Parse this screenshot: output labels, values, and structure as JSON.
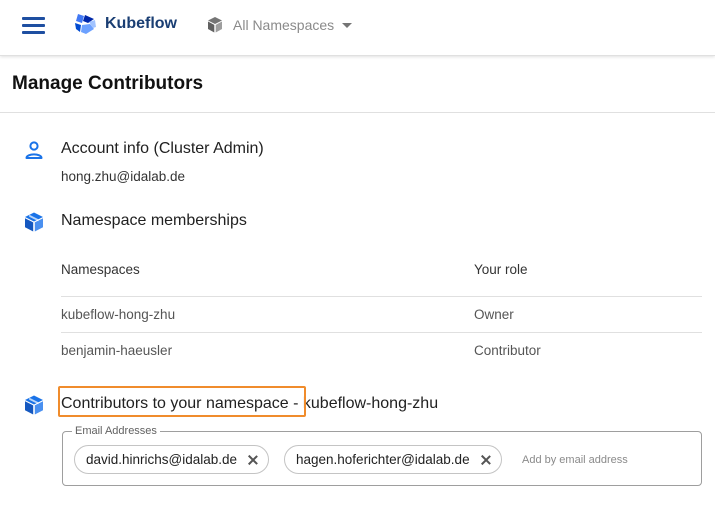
{
  "topbar": {
    "app_name": "Kubeflow",
    "namespace_selector": "All Namespaces"
  },
  "page": {
    "title": "Manage Contributors"
  },
  "account": {
    "title": "Account info  (Cluster Admin)",
    "email": "hong.zhu@idalab.de"
  },
  "memberships": {
    "title": "Namespace memberships",
    "columns": [
      "Namespaces",
      "Your role"
    ],
    "rows": [
      {
        "namespace": "kubeflow-hong-zhu",
        "role": "Owner"
      },
      {
        "namespace": "benjamin-haeusler",
        "role": "Contributor"
      }
    ]
  },
  "contributors": {
    "title": "Contributors to your namespace",
    "title_suffix": " - kubeflow-hong-zhu",
    "field_label": "Email Addresses",
    "chips": [
      "david.hinrichs@idalab.de",
      "hagen.hoferichter@idalab.de"
    ],
    "placeholder": "Add by email address"
  },
  "colors": {
    "brand": "#1e4fa1",
    "icon_blue": "#1a73e8",
    "highlight": "#f08c2c"
  },
  "icons": {
    "menu": "menu-icon",
    "logo": "kubeflow-logo",
    "namespace": "cube-icon",
    "account": "person-icon",
    "memberships": "cube-icon",
    "contributors": "cube-icon",
    "chip_remove": "close-icon"
  }
}
